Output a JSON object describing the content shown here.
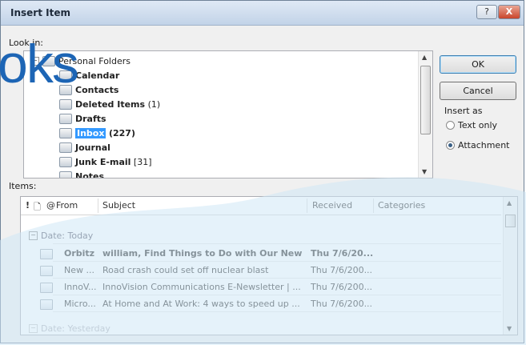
{
  "window": {
    "title": "Insert Item",
    "help_glyph": "?",
    "close_glyph": "X"
  },
  "look_in": {
    "label": "Look in:"
  },
  "tree": {
    "items": [
      {
        "label": "Personal Folders",
        "count": ""
      },
      {
        "label": "Calendar",
        "count": ""
      },
      {
        "label": "Contacts",
        "count": ""
      },
      {
        "label": "Deleted Items",
        "count": "(1)"
      },
      {
        "label": "Drafts",
        "count": ""
      },
      {
        "label": "Inbox",
        "count": "(227)"
      },
      {
        "label": "Journal",
        "count": ""
      },
      {
        "label": "Junk E-mail",
        "count": "[31]"
      },
      {
        "label": "Notes",
        "count": ""
      }
    ],
    "selected": "Inbox"
  },
  "buttons": {
    "ok": "OK",
    "cancel": "Cancel"
  },
  "insert_as": {
    "label": "Insert as",
    "options": [
      "Text only",
      "Attachment"
    ],
    "selected": "Attachment"
  },
  "items": {
    "label": "Items:",
    "columns": [
      "!",
      "",
      "",
      "From",
      "Subject",
      "Received",
      "Categories"
    ],
    "groups": [
      {
        "label": "Date: Today"
      },
      {
        "label": "Date: Yesterday"
      }
    ],
    "rows": [
      {
        "from": "Orbitz",
        "subject": "william, Find Things to Do with Our New A...",
        "received": "Thu 7/6/20...",
        "unread": true
      },
      {
        "from": "New ...",
        "subject": "Road crash could set off nuclear blast",
        "received": "Thu 7/6/200...",
        "unread": false
      },
      {
        "from": "InnoV...",
        "subject": "InnoVision Communications E-Newsletter | ...",
        "received": "Thu 7/6/200...",
        "unread": false
      },
      {
        "from": "Micro...",
        "subject": "At Home and At Work: 4 ways to speed up ...",
        "received": "Thu 7/6/200...",
        "unread": false
      }
    ]
  },
  "overlay": {
    "logo_text": "oks",
    "accent_color": "#1d65b5",
    "wave_color": "#cfe8f5"
  }
}
